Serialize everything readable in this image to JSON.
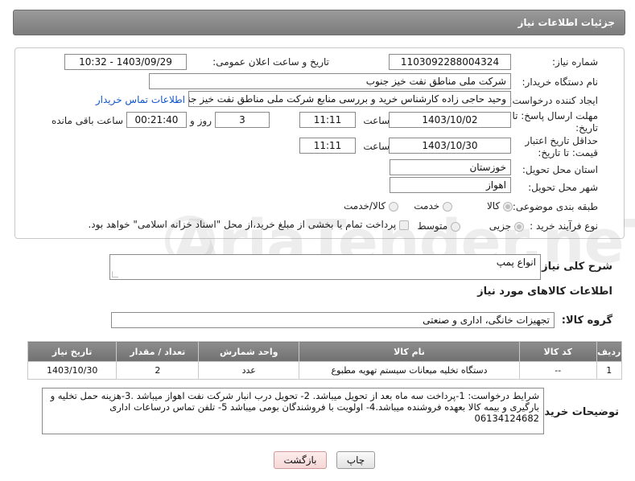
{
  "header": {
    "title": "جزئیات اطلاعات نیاز"
  },
  "form": {
    "need_number_label": "شماره نیاز:",
    "need_number": "1103092288004324",
    "announce_label": "تاریخ و ساعت اعلان عمومی:",
    "announce_value": "1403/09/29 - 10:32",
    "buyer_org_label": "نام دستگاه خریدار:",
    "buyer_org": "شرکت ملی مناطق نفت خیز جنوب",
    "creator_label": "ایجاد کننده درخواست:",
    "creator": "وحید حاجی زاده  کارشناس خرید و بررسی منابع  شرکت ملی مناطق نفت خیز جنوب",
    "contact_link": "اطلاعات تماس خریدار",
    "deadline_label": "مهلت ارسال پاسخ: تا تاریخ:",
    "deadline_date": "1403/10/02",
    "time_label": "ساعت",
    "deadline_time": "11:11",
    "days_value": "3",
    "days_label": "روز و",
    "remaining_time": "00:21:40",
    "remaining_label": "ساعت باقی مانده",
    "validity_label": "حداقل تاریخ اعتبار قیمت: تا تاریخ:",
    "validity_date": "1403/10/30",
    "validity_time": "11:11",
    "province_label": "استان محل تحویل:",
    "province": "خوزستان",
    "city_label": "شهر محل تحویل:",
    "city": "اهواز",
    "category_label": "طبقه بندی موضوعی:",
    "category_options": [
      "کالا",
      "خدمت",
      "کالا/خدمت"
    ],
    "process_label": "نوع فرآیند خرید :",
    "process_options": [
      "جزیی",
      "متوسط"
    ],
    "payment_note": "پرداخت تمام یا بخشی از مبلغ خرید،از محل \"اسناد خزانه اسلامی\" خواهد بود."
  },
  "summary": {
    "label": "شرح کلی نیاز:",
    "value": "انواع پمپ"
  },
  "goods_section": {
    "title": "اطلاعات کالاهای مورد نیاز",
    "group_label": "گروه کالا:",
    "group_value": "تجهیزات خانگی، اداری و صنعتی"
  },
  "table": {
    "headers": [
      "ردیف",
      "کد کالا",
      "نام کالا",
      "واحد شمارش",
      "تعداد / مقدار",
      "تاریخ نیاز"
    ],
    "rows": [
      [
        "1",
        "--",
        "دستگاه تخلیه میعانات سیستم تهویه مطبوع",
        "عدد",
        "2",
        "1403/10/30"
      ]
    ]
  },
  "notes": {
    "label": "توضیحات خریدار:",
    "value": "شرایط درخواست: 1-پرداخت سه ماه بعد از تحویل میباشد. 2- تحویل درب انبار شرکت نفت اهواز میباشد .3-هزینه حمل تخلیه و بارگیری و بیمه کالا بعهده فروشنده میباشد.4-   اولویت با فروشندگان بومی میباشد 5- تلفن تماس درساعات اداری 06134124682"
  },
  "buttons": {
    "print": "چاپ",
    "back": "بازگشت"
  },
  "watermark": {
    "text": "AriaTender.neT"
  }
}
